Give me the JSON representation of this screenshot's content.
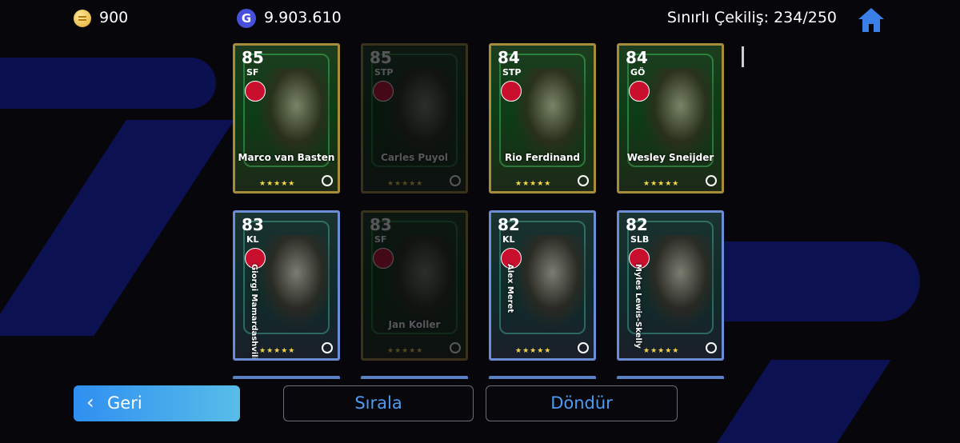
{
  "topbar": {
    "coins": "900",
    "gp": "9.903.610",
    "gp_icon_letter": "G",
    "draw_label": "Sınırlı Çekiliş: 234/250"
  },
  "cards": [
    {
      "rating": "85",
      "position": "SF",
      "name": "Marco van Basten",
      "stars": "★★★★★",
      "dimmed": false,
      "color": "gold"
    },
    {
      "rating": "85",
      "position": "STP",
      "name": "Carles Puyol",
      "stars": "★★★★★",
      "dimmed": true,
      "color": "gold"
    },
    {
      "rating": "84",
      "position": "STP",
      "name": "Rio Ferdinand",
      "stars": "★★★★★",
      "dimmed": false,
      "color": "gold"
    },
    {
      "rating": "84",
      "position": "GÖ",
      "name": "Wesley Sneijder",
      "stars": "★★★★★",
      "dimmed": false,
      "color": "gold"
    },
    {
      "rating": "83",
      "position": "KL",
      "name": "Giorgi Mamardashvili",
      "stars": "★★★★★",
      "dimmed": false,
      "color": "blue"
    },
    {
      "rating": "83",
      "position": "SF",
      "name": "Jan Koller",
      "stars": "★★★★★",
      "dimmed": true,
      "color": "gold"
    },
    {
      "rating": "82",
      "position": "KL",
      "name": "Alex Meret",
      "stars": "★★★★★",
      "dimmed": false,
      "color": "blue"
    },
    {
      "rating": "82",
      "position": "SLB",
      "name": "Myles Lewis-Skelly",
      "stars": "★★★★★",
      "dimmed": false,
      "color": "blue"
    }
  ],
  "buttons": {
    "back": "Geri",
    "back_chevron": "‹",
    "sort": "Sırala",
    "rotate": "Döndür"
  },
  "icons": {
    "coin": "coin-icon",
    "gp": "gp-icon",
    "home": "home-icon"
  },
  "colors": {
    "back_button": "#2f8ff1",
    "outline_text": "#4d9cf4",
    "home_icon": "#3b7fe8"
  }
}
